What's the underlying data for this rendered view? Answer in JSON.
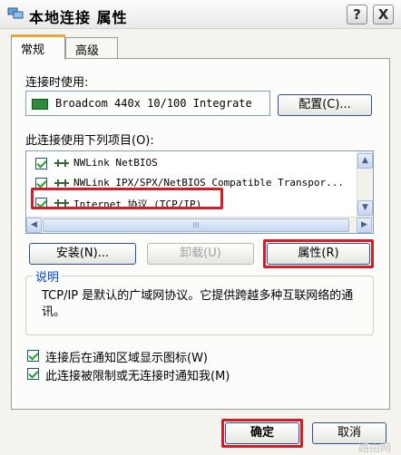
{
  "window": {
    "title": "本地连接  属性",
    "help_button": "?",
    "close_button": "X"
  },
  "tabs": [
    {
      "label": "常规",
      "active": true
    },
    {
      "label": "高级",
      "active": false
    }
  ],
  "connect_using": {
    "label": "连接时使用:",
    "adapter": "Broadcom 440x 10/100 Integrate",
    "configure_button": "配置(C)..."
  },
  "components": {
    "label": "此连接使用下列项目(O):",
    "items": [
      {
        "checked": true,
        "text": "NWLink NetBIOS"
      },
      {
        "checked": true,
        "text": "NWLink IPX/SPX/NetBIOS Compatible Transpor..."
      },
      {
        "checked": true,
        "text": "Internet 协议 (TCP/IP)"
      }
    ],
    "scroll_grip": "III"
  },
  "actions": {
    "install": "安装(N)...",
    "uninstall": "卸载(U)",
    "properties": "属性(R)"
  },
  "description": {
    "legend": "说明",
    "text": "TCP/IP 是默认的广域网协议。它提供跨越多种互联网络的通讯。"
  },
  "options": [
    {
      "checked": true,
      "label": "连接后在通知区域显示图标(W)"
    },
    {
      "checked": true,
      "label": "此连接被限制或无连接时通知我(M)"
    }
  ],
  "footer": {
    "ok": "确定",
    "cancel": "取消"
  },
  "watermark": "路由网",
  "colors": {
    "highlight": "#d21e2a",
    "group_legend": "#0046d5",
    "tab_active_top": "#e9a83b"
  }
}
